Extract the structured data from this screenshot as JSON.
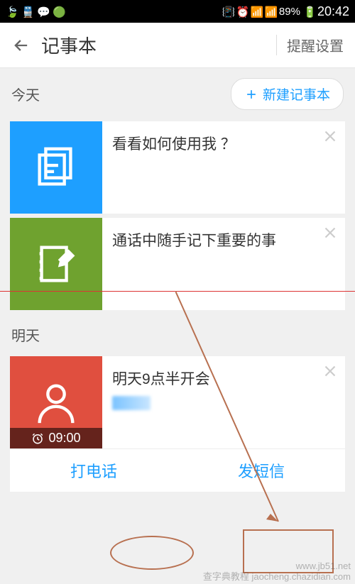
{
  "status": {
    "battery": "89%",
    "time": "20:42"
  },
  "header": {
    "title": "记事本",
    "settings": "提醒设置"
  },
  "sections": {
    "today": "今天",
    "tomorrow": "明天",
    "new_button": "新建记事本"
  },
  "notes": {
    "n1": {
      "text": "看看如何使用我 ？"
    },
    "n2": {
      "text": "通话中随手记下重要的事"
    },
    "n3": {
      "text": "明天9点半开会",
      "alarm": "09:00"
    }
  },
  "actions": {
    "call": "打电话",
    "sms": "发短信"
  },
  "watermark": {
    "line1": "www.jb51.net",
    "line2": "查字典教程 jaocheng.chazidian.com"
  }
}
